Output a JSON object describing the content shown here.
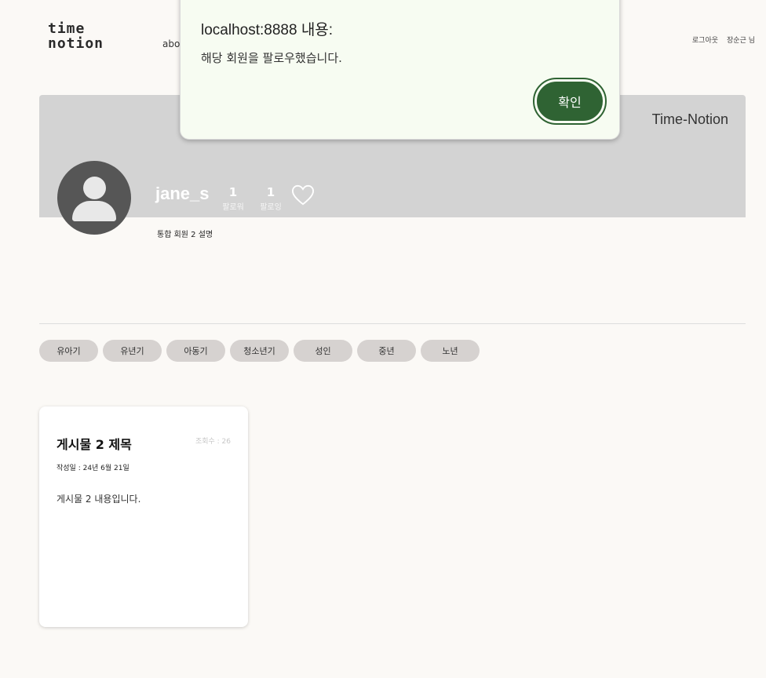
{
  "header": {
    "logo_line1": "time",
    "logo_line2": "notion",
    "nav_about": "abo",
    "logout": "로그아웃",
    "user_greeting": "장순근 님"
  },
  "banner": {
    "title": "Time-Notion"
  },
  "profile": {
    "username": "jane_s",
    "followers_count": "1",
    "followers_label": "팔로워",
    "following_count": "1",
    "following_label": "팔로잉",
    "description": "통합 회원 2 설명"
  },
  "categories": [
    "유아기",
    "유년기",
    "아동기",
    "청소년기",
    "성인",
    "중년",
    "노년"
  ],
  "post": {
    "title": "게시물 2 제목",
    "views": "조회수 : 26",
    "date": "작성일 : 24년 6월 21일",
    "content": "게시물 2 내용입니다."
  },
  "dialog": {
    "title": "localhost:8888 내용:",
    "message": "해당 회원을 팔로우했습니다.",
    "ok_label": "확인"
  },
  "colors": {
    "background": "#fbf9f6",
    "banner": "#d3d3d3",
    "pill": "#d6d2d0",
    "dialog_bg": "#f7fcf2",
    "ok_button": "#2f6333"
  }
}
